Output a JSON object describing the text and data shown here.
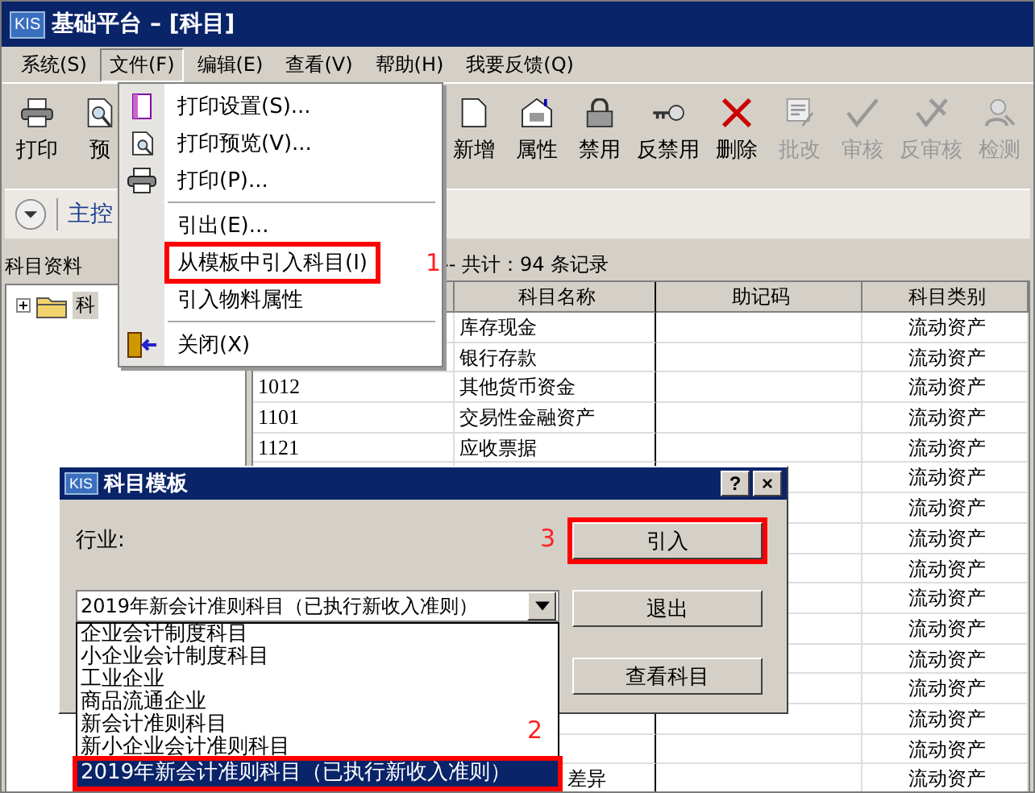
{
  "window": {
    "title": "基础平台 – [科目]",
    "logo": "KIS"
  },
  "menu_bar": [
    {
      "label": "系统(S)",
      "selected": false
    },
    {
      "label": "文件(F)",
      "selected": true
    },
    {
      "label": "编辑(E)",
      "selected": false
    },
    {
      "label": "查看(V)",
      "selected": false
    },
    {
      "label": "帮助(H)",
      "selected": false
    },
    {
      "label": "我要反馈(Q)",
      "selected": false
    }
  ],
  "toolbar": [
    {
      "label": "打印",
      "disabled": false
    },
    {
      "label": "预",
      "disabled": false
    },
    {
      "label": "新增",
      "disabled": false
    },
    {
      "label": "属性",
      "disabled": false
    },
    {
      "label": "禁用",
      "disabled": false
    },
    {
      "label": "反禁用",
      "disabled": false
    },
    {
      "label": "删除",
      "disabled": false
    },
    {
      "label": "批改",
      "disabled": true
    },
    {
      "label": "审核",
      "disabled": true
    },
    {
      "label": "反审核",
      "disabled": true
    },
    {
      "label": "检测",
      "disabled": true
    }
  ],
  "nav": {
    "label": "主控"
  },
  "left_panel": {
    "title": "科目资料",
    "tree": [
      {
        "label": "科",
        "expanded": false
      }
    ]
  },
  "table": {
    "summary": "-- 共计：94 条记录",
    "columns": [
      "科目名称",
      "助记码",
      "科目类别"
    ],
    "rows": [
      {
        "name": "库存现金",
        "category": "流动资产"
      },
      {
        "name": "银行存款",
        "category": "流动资产"
      },
      {
        "code": "1012",
        "name": "其他货币资金",
        "category": "流动资产"
      },
      {
        "code": "1101",
        "name": "交易性金融资产",
        "category": "流动资产"
      },
      {
        "code": "1121",
        "name": "应收票据",
        "category": "流动资产"
      },
      {
        "category": "流动资产"
      },
      {
        "category": "流动资产"
      },
      {
        "category": "流动资产"
      },
      {
        "category": "流动资产"
      },
      {
        "category": "流动资产"
      },
      {
        "category": "流动资产"
      },
      {
        "category": "流动资产"
      },
      {
        "category": "流动资产"
      },
      {
        "category": "流动资产"
      },
      {
        "category": "流动资产"
      },
      {
        "name": "差异",
        "category": "流动资产"
      }
    ]
  },
  "file_menu": [
    {
      "kind": "item",
      "label": "打印设置(S)...",
      "highlighted": false
    },
    {
      "kind": "item",
      "label": "打印预览(V)...",
      "highlighted": false
    },
    {
      "kind": "item",
      "label": "打印(P)...",
      "highlighted": false
    },
    {
      "kind": "separator"
    },
    {
      "kind": "item",
      "label": "引出(E)...",
      "highlighted": false
    },
    {
      "kind": "item",
      "label": "从模板中引入科目(I)",
      "highlighted": true,
      "annotation": "1"
    },
    {
      "kind": "item",
      "label": "引入物料属性",
      "highlighted": false
    },
    {
      "kind": "separator"
    },
    {
      "kind": "item",
      "label": "关闭(X)",
      "highlighted": false
    }
  ],
  "dialog": {
    "logo": "KIS",
    "title": "科目模板",
    "controls": [
      "?",
      "×"
    ],
    "label": "行业:",
    "combo_value": "2019年新会计准则科目（已执行新收入准则）",
    "options": [
      {
        "label": "企业会计制度科目",
        "selected": false,
        "highlighted": false
      },
      {
        "label": "小企业会计制度科目",
        "selected": false,
        "highlighted": false
      },
      {
        "label": "工业企业",
        "selected": false,
        "highlighted": false
      },
      {
        "label": "商品流通企业",
        "selected": false,
        "highlighted": false
      },
      {
        "label": "新会计准则科目",
        "selected": false,
        "highlighted": false
      },
      {
        "label": "新小企业会计准则科目",
        "selected": false,
        "highlighted": false
      },
      {
        "label": "2019年新会计准则科目（已执行新收入准则）",
        "selected": true,
        "highlighted": true,
        "annotation": "2"
      }
    ],
    "buttons": [
      {
        "label": "引入",
        "highlighted": true,
        "annotation": "3"
      },
      {
        "label": "退出",
        "highlighted": false
      },
      {
        "label": "查看科目",
        "highlighted": false
      }
    ]
  }
}
